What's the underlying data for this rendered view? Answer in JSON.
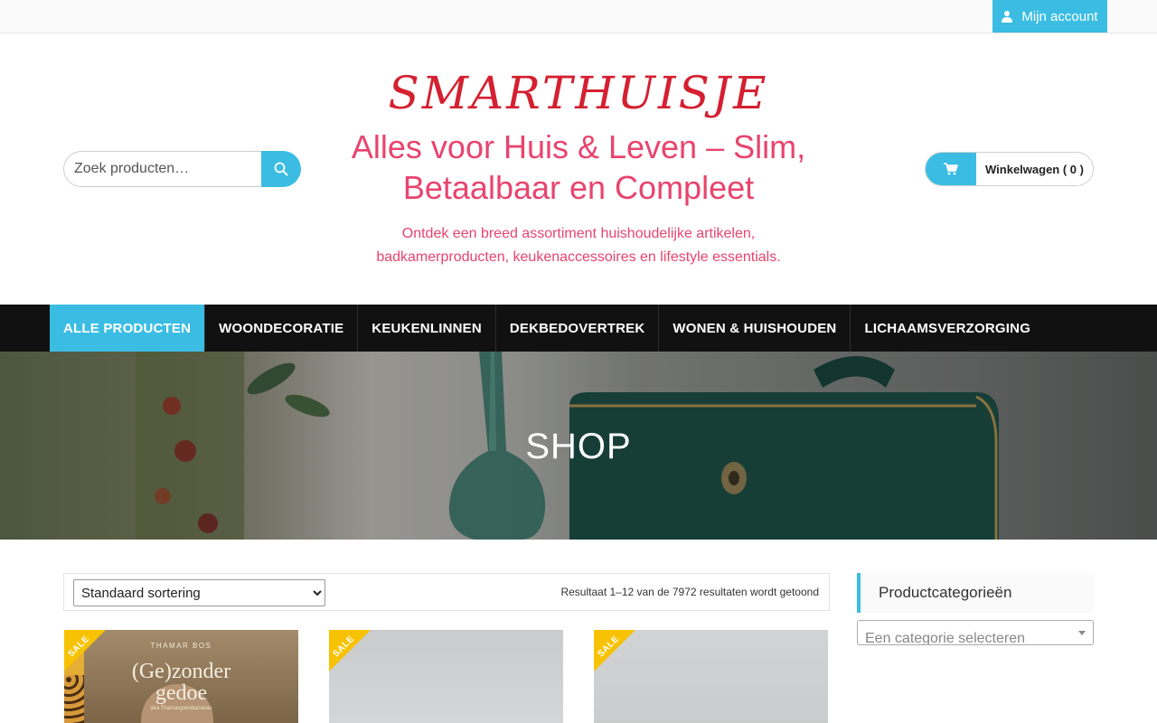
{
  "topbar": {
    "account_label": "Mijn account",
    "account_icon": "user-icon"
  },
  "header": {
    "logo": "SMARTHUISJE",
    "tagline": "Alles voor Huis & Leven – Slim, Betaalbaar en Compleet",
    "description": "Ontdek een breed assortiment huishoudelijke artikelen, badkamerproducten, keukenaccessoires en lifestyle essentials.",
    "search": {
      "placeholder": "Zoek producten…",
      "icon": "search-icon"
    },
    "cart": {
      "label": "Winkelwagen ( 0 )",
      "icon": "cart-icon"
    }
  },
  "nav": {
    "items": [
      {
        "label": "ALLE PRODUCTEN",
        "active": true
      },
      {
        "label": "WOONDECORATIE"
      },
      {
        "label": "KEUKENLINNEN"
      },
      {
        "label": "DEKBEDOVERTREK"
      },
      {
        "label": "WONEN & HUISHOUDEN"
      },
      {
        "label": "LICHAAMSVERZORGING"
      }
    ]
  },
  "hero": {
    "title": "SHOP"
  },
  "toolbar": {
    "sort_selected": "Standaard sortering",
    "result_count": "Resultaat 1–12 van de 7972 resultaten wordt getoond"
  },
  "products": [
    {
      "badge": "SALE",
      "book_author": "THAMAR BOS",
      "book_title_line1": "(Ge)zonder",
      "book_title_line2": "gedoe",
      "book_subtitle": "aka Thamargoesbananas"
    },
    {
      "badge": "SALE"
    },
    {
      "badge": "SALE"
    }
  ],
  "sidebar": {
    "widget_title": "Productcategorieën",
    "category_placeholder": "Een categorie selecteren"
  },
  "colors": {
    "accent": "#3bbde3",
    "logo": "#d42030",
    "tagline": "#e8446e",
    "nav_bg": "#111111",
    "sale": "#f7c204"
  }
}
